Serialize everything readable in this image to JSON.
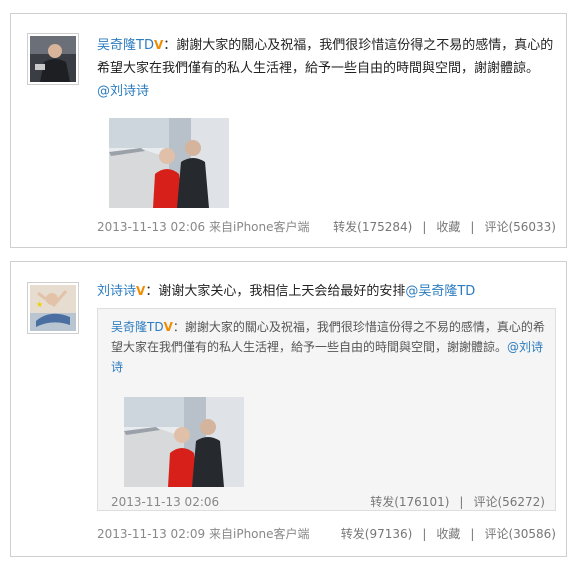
{
  "post1": {
    "author": "吴奇隆TD",
    "verified_badge": "V",
    "text": "：謝謝大家的關心及祝福，我們很珍惜這份得之不易的感情，真心的希望大家在我們僅有的私人生活裡，給予一些自由的時間與空間，謝謝體諒。",
    "mention": "@刘诗诗",
    "time": "2013-11-13 02:06",
    "source": "来自iPhone客户端",
    "repost_label": "转发(175284)",
    "favorite_label": "收藏",
    "comment_label": "评论(56033)"
  },
  "post2": {
    "author": "刘诗诗",
    "verified_badge": "V",
    "text": "：谢谢大家关心，我相信上天会给最好的安排",
    "mention": "@吴奇隆TD",
    "time": "2013-11-13 02:09",
    "source": "来自iPhone客户端",
    "repost_label": "转发(97136)",
    "favorite_label": "收藏",
    "comment_label": "评论(30586)",
    "quoted": {
      "author": "吴奇隆TD",
      "verified_badge": "V",
      "text": "：謝謝大家的關心及祝福，我們很珍惜這份得之不易的感情，真心的希望大家在我們僅有的私人生活裡，給予一些自由的時間與空間，謝謝體諒。",
      "mention": "@刘诗诗",
      "time": "2013-11-13 02:06",
      "repost_label": "转发(176101)",
      "comment_label": "评论(56272)"
    }
  },
  "colors": {
    "link": "#2b7cc0",
    "verified": "#f08c00",
    "meta_text": "#888888",
    "quote_bg": "#f5f5f5"
  }
}
